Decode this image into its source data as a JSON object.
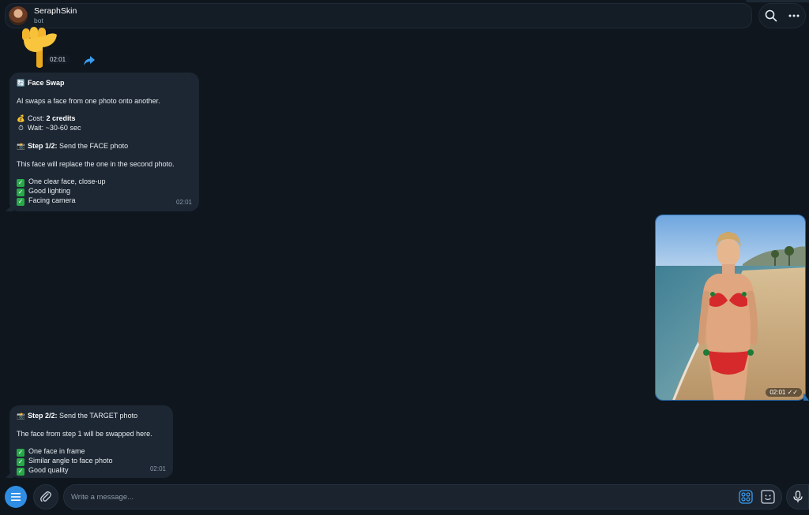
{
  "header": {
    "title": "SeraphSkin",
    "subtitle": "bot",
    "icons": [
      "search-icon",
      "more-icon"
    ]
  },
  "sticker": {
    "icon": "pointing-down-hand-icon",
    "time": "02:01"
  },
  "messages": [
    {
      "title": "Face Swap",
      "intro": "AI swaps a face from one photo onto another.",
      "cost_label": "Cost: ",
      "cost_value": "2 credits",
      "wait": "Wait: ~30-60 sec",
      "step_label": "Step 1/2:",
      "step_text": " Send the FACE photo",
      "note": "This face will replace the one in the second photo.",
      "checks": [
        "One clear face, close-up",
        "Good lighting",
        "Facing camera"
      ],
      "time": "02:01"
    },
    {
      "step_label": "Step 2/2:",
      "step_text": " Send the TARGET photo",
      "note": "The face from step 1 will be swapped here.",
      "checks": [
        "One face in frame",
        "Similar angle to face photo",
        "Good quality"
      ],
      "time": "02:01"
    }
  ],
  "outgoing_photo": {
    "time": "02:01",
    "status_icon": "double-check-icon"
  },
  "composer": {
    "placeholder": "Write a message...",
    "icons": [
      "menu-icon",
      "attach-icon",
      "apps-icon",
      "sticker-icon",
      "microphone-icon"
    ]
  },
  "colors": {
    "background": "#0f161e",
    "bubble": "#1d2733",
    "accent": "#2f8de4",
    "check": "#29a84a"
  }
}
